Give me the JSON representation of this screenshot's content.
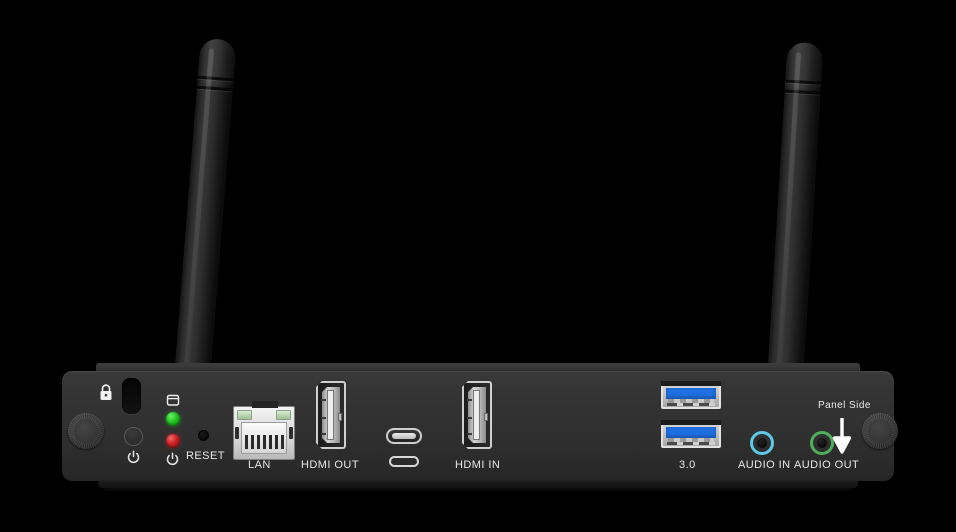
{
  "device": {
    "type": "media-player-rear-io-panel",
    "orientation_note": "Panel Side",
    "accent_colors": {
      "usb3_blue": "#1f6fe0",
      "audio_in_ring": "#5ec8e8",
      "audio_out_ring": "#4fae5a",
      "led_green": "#23c723",
      "led_red": "#cf2222",
      "chassis": "#303030",
      "background": "#000000"
    }
  },
  "antennas": [
    {
      "name": "antenna-left",
      "label": ""
    },
    {
      "name": "antenna-right",
      "label": ""
    }
  ],
  "panel": {
    "labels": {
      "reset": "RESET",
      "lan": "LAN",
      "hdmi_out": "HDMI OUT",
      "usb_c": "",
      "hdmi_in": "HDMI IN",
      "usb3": "3.0",
      "audio_in": "AUDIO IN",
      "audio_out": "AUDIO OUT",
      "panel_side": "Panel Side"
    },
    "icons": {
      "kensington_lock": "padlock-icon",
      "storage_led": "hard-drive-icon",
      "power_led": "power-symbol-icon",
      "power_button": "power-symbol-icon",
      "direction": "down-arrow-icon",
      "usb_c_symbol": "usb-c-outline-icon"
    },
    "indicators": [
      {
        "name": "storage-activity-led",
        "color": "#23c723",
        "state": "green"
      },
      {
        "name": "power-status-led",
        "color": "#cf2222",
        "state": "red"
      }
    ],
    "ports": [
      {
        "name": "kensington-lock-slot",
        "label": ""
      },
      {
        "name": "power-button",
        "label": ""
      },
      {
        "name": "reset-pinhole",
        "label": "RESET"
      },
      {
        "name": "lan-port",
        "label": "LAN"
      },
      {
        "name": "hdmi-out-port",
        "label": "HDMI OUT"
      },
      {
        "name": "usb-c-port",
        "label": ""
      },
      {
        "name": "hdmi-in-port",
        "label": "HDMI IN"
      },
      {
        "name": "usb3-port-top",
        "label": "3.0"
      },
      {
        "name": "usb3-port-bottom",
        "label": "3.0"
      },
      {
        "name": "audio-in-jack",
        "label": "AUDIO IN"
      },
      {
        "name": "audio-out-jack",
        "label": "AUDIO OUT"
      }
    ],
    "fasteners": [
      {
        "name": "thumbscrew-left"
      },
      {
        "name": "thumbscrew-right"
      }
    ]
  }
}
